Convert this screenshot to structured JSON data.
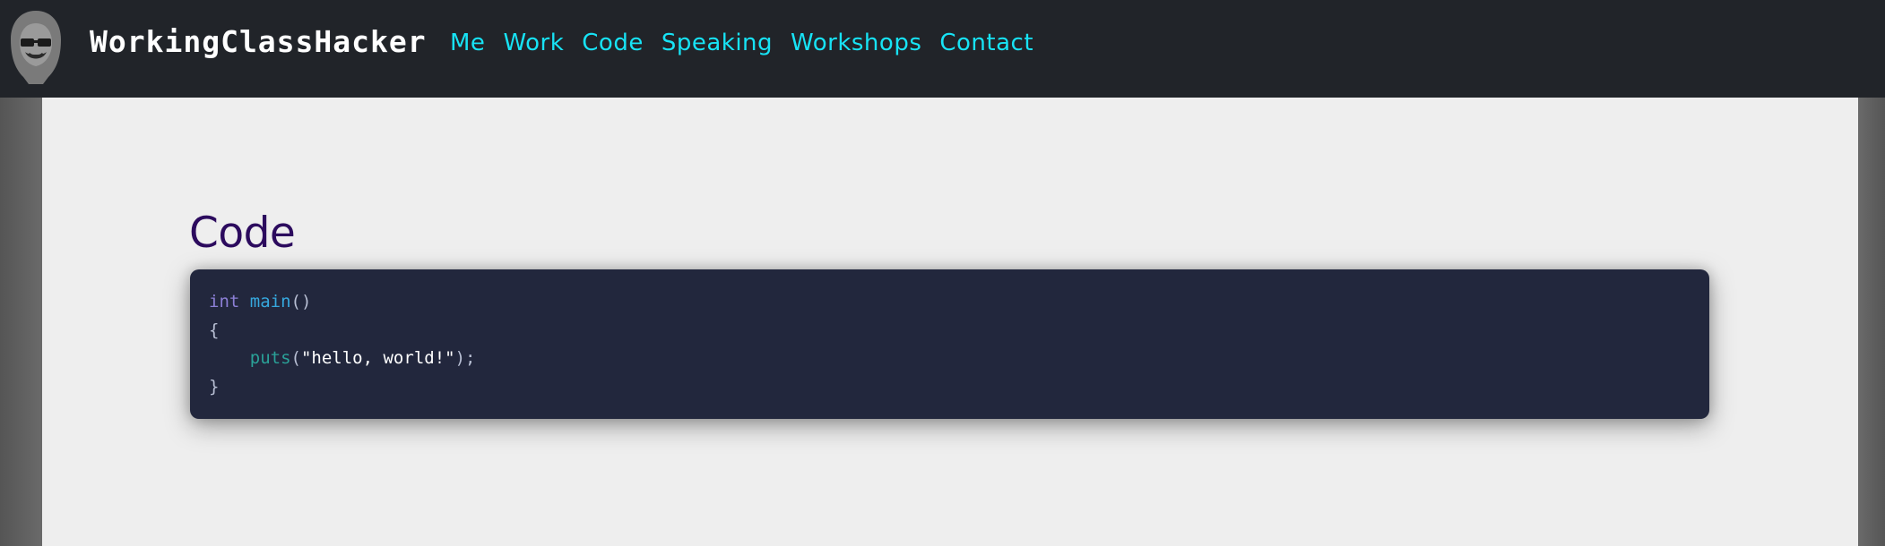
{
  "header": {
    "brand": "WorkingClassHacker",
    "logo_icon": "hooded-hacker-icon",
    "nav": [
      {
        "label": "Me"
      },
      {
        "label": "Work"
      },
      {
        "label": "Code"
      },
      {
        "label": "Speaking"
      },
      {
        "label": "Workshops"
      },
      {
        "label": "Contact"
      }
    ]
  },
  "main": {
    "title": "Code",
    "code": {
      "line1": {
        "kw": "int",
        "fn": "main",
        "pun": "()"
      },
      "line2": {
        "pun": "{"
      },
      "line3": {
        "indent": "    ",
        "call": "puts",
        "open": "(",
        "str": "\"hello, world!\"",
        "close": ");"
      },
      "line4": {
        "pun": "}"
      }
    }
  },
  "colors": {
    "topbar": "#212429",
    "nav_link": "#17e3f5",
    "title": "#2c0b5e",
    "code_bg": "#22273d",
    "content_bg": "#eeeeee"
  }
}
